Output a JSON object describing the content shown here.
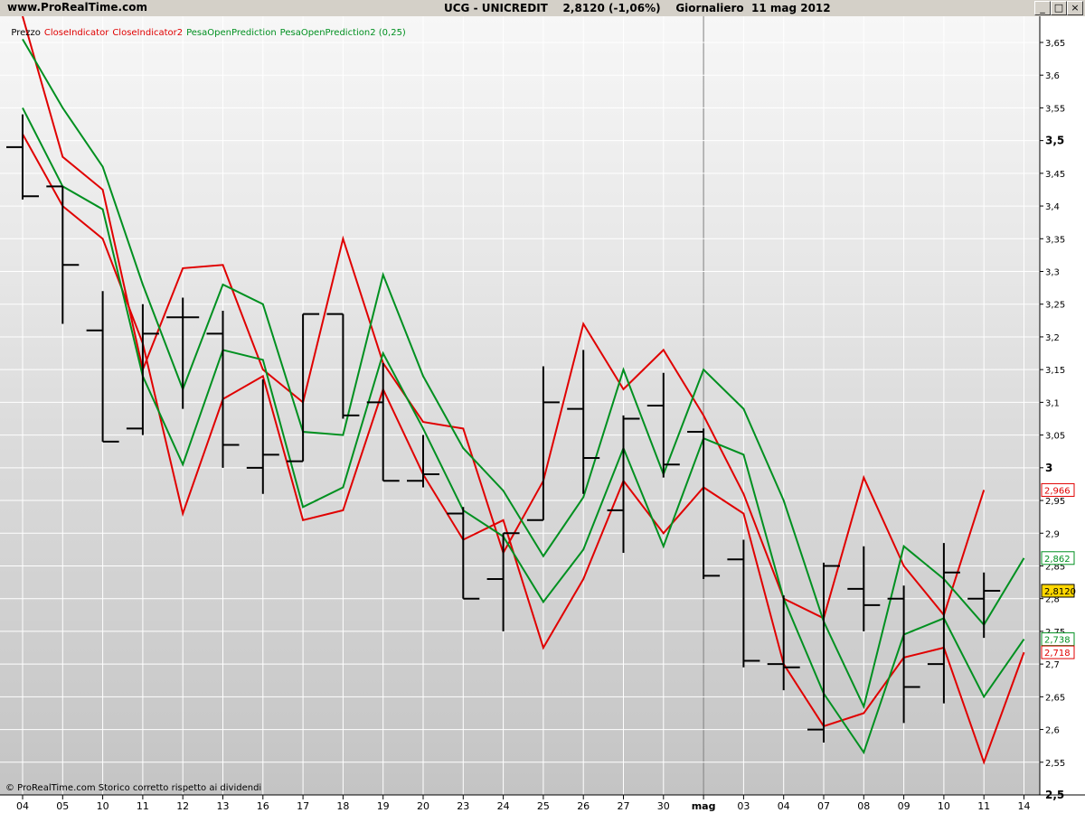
{
  "header": {
    "site": "www.ProRealTime.com",
    "title": "UCG - UNICREDIT    2,8120 (-1,06%)    Giornaliero  11 mag 2012"
  },
  "legend": {
    "price": "Prezzo",
    "ind1": "CloseIndicator",
    "ind2": "CloseIndicator2",
    "ind3": "PesaOpenPrediction",
    "ind4": "PesaOpenPrediction2 (0,25)"
  },
  "footer": "© ProRealTime.com  Storico corretto rispetto ai dividendi",
  "window_controls": [
    "_",
    "□",
    "×"
  ],
  "colors": {
    "price": "#000000",
    "close_indicator": "#e00000",
    "pesa_prediction": "#009020",
    "last_price_badge": "#ffd700"
  },
  "chart_data": {
    "type": "line",
    "title": "UCG - UNICREDIT",
    "x_labels": [
      "04",
      "05",
      "10",
      "11",
      "12",
      "13",
      "16",
      "17",
      "18",
      "19",
      "20",
      "23",
      "24",
      "25",
      "26",
      "27",
      "30",
      "mag",
      "03",
      "04",
      "07",
      "08",
      "09",
      "10",
      "11",
      "14"
    ],
    "ylim": [
      2.5,
      3.69
    ],
    "y_ticks": [
      "3,65",
      "3,6",
      "3,55",
      "3,5",
      "3,45",
      "3,4",
      "3,35",
      "3,3",
      "3,25",
      "3,2",
      "3,15",
      "3,1",
      "3,05",
      "3",
      "2,95",
      "2,9",
      "2,85",
      "2,8",
      "2,75",
      "2,7",
      "2,65",
      "2,6",
      "2,55",
      "2,5"
    ],
    "y_ticks_bold": [
      "3,5",
      "3",
      "2,5"
    ],
    "month_divider_index": 17,
    "ohlc": [
      {
        "o": 3.49,
        "h": 3.54,
        "l": 3.41,
        "c": 3.415
      },
      {
        "o": 3.43,
        "h": 3.43,
        "l": 3.22,
        "c": 3.31
      },
      {
        "o": 3.21,
        "h": 3.27,
        "l": 3.04,
        "c": 3.04
      },
      {
        "o": 3.06,
        "h": 3.25,
        "l": 3.05,
        "c": 3.205
      },
      {
        "o": 3.23,
        "h": 3.26,
        "l": 3.09,
        "c": 3.23
      },
      {
        "o": 3.205,
        "h": 3.24,
        "l": 3.0,
        "c": 3.035
      },
      {
        "o": 3.0,
        "h": 3.135,
        "l": 2.96,
        "c": 3.02
      },
      {
        "o": 3.01,
        "h": 3.235,
        "l": 3.01,
        "c": 3.235
      },
      {
        "o": 3.235,
        "h": 3.235,
        "l": 3.075,
        "c": 3.08
      },
      {
        "o": 3.1,
        "h": 3.16,
        "l": 2.98,
        "c": 2.98
      },
      {
        "o": 2.98,
        "h": 3.05,
        "l": 2.97,
        "c": 2.99
      },
      {
        "o": 2.93,
        "h": 2.94,
        "l": 2.8,
        "c": 2.8
      },
      {
        "o": 2.83,
        "h": 2.9,
        "l": 2.75,
        "c": 2.9
      },
      {
        "o": 2.92,
        "h": 3.155,
        "l": 2.92,
        "c": 3.1
      },
      {
        "o": 3.09,
        "h": 3.18,
        "l": 2.96,
        "c": 3.015
      },
      {
        "o": 2.935,
        "h": 3.08,
        "l": 2.87,
        "c": 3.075
      },
      {
        "o": 3.095,
        "h": 3.145,
        "l": 2.985,
        "c": 3.005
      },
      {
        "o": 3.055,
        "h": 3.06,
        "l": 2.83,
        "c": 2.835
      },
      {
        "o": 2.86,
        "h": 2.89,
        "l": 2.695,
        "c": 2.705
      },
      {
        "o": 2.7,
        "h": 2.805,
        "l": 2.66,
        "c": 2.695
      },
      {
        "o": 2.6,
        "h": 2.855,
        "l": 2.58,
        "c": 2.85
      },
      {
        "o": 2.815,
        "h": 2.88,
        "l": 2.75,
        "c": 2.79
      },
      {
        "o": 2.8,
        "h": 2.82,
        "l": 2.61,
        "c": 2.665
      },
      {
        "o": 2.7,
        "h": 2.885,
        "l": 2.64,
        "c": 2.84
      },
      {
        "o": 2.8,
        "h": 2.84,
        "l": 2.74,
        "c": 2.812
      }
    ],
    "series": [
      {
        "name": "CloseIndicator",
        "color": "#e00000",
        "values": [
          3.69,
          3.475,
          3.425,
          3.15,
          3.305,
          3.31,
          3.15,
          3.1,
          3.35,
          3.16,
          3.07,
          3.06,
          2.87,
          2.98,
          3.22,
          3.12,
          3.18,
          3.08,
          2.96,
          2.8,
          2.77,
          2.985,
          2.85,
          2.775,
          2.966
        ]
      },
      {
        "name": "CloseIndicator2",
        "color": "#e00000",
        "values": [
          3.51,
          3.4,
          3.35,
          3.19,
          2.93,
          3.105,
          3.14,
          2.92,
          2.935,
          3.12,
          2.99,
          2.89,
          2.92,
          2.725,
          2.83,
          2.98,
          2.9,
          2.97,
          2.93,
          2.7,
          2.605,
          2.625,
          2.71,
          2.725,
          2.55,
          2.718
        ]
      },
      {
        "name": "PesaOpenPrediction",
        "color": "#009020",
        "values": [
          3.655,
          3.55,
          3.46,
          3.28,
          3.12,
          3.28,
          3.25,
          3.055,
          3.05,
          3.295,
          3.14,
          3.03,
          2.965,
          2.865,
          2.955,
          3.15,
          2.99,
          3.15,
          3.09,
          2.95,
          2.765,
          2.635,
          2.88,
          2.83,
          2.76,
          2.862
        ]
      },
      {
        "name": "PesaOpenPrediction2 (0,25)",
        "color": "#009020",
        "values": [
          3.55,
          3.43,
          3.395,
          3.14,
          3.005,
          3.18,
          3.165,
          2.94,
          2.97,
          3.175,
          3.06,
          2.935,
          2.895,
          2.795,
          2.875,
          3.03,
          2.88,
          3.045,
          3.02,
          2.8,
          2.655,
          2.565,
          2.745,
          2.77,
          2.65,
          2.738
        ]
      }
    ],
    "axis_badges": [
      {
        "label": "2,966",
        "value": 2.966,
        "color": "#e00000",
        "fill": "#ffffff"
      },
      {
        "label": "2,862",
        "value": 2.862,
        "color": "#009020",
        "fill": "#ffffff"
      },
      {
        "label": "2,8120",
        "value": 2.812,
        "color": "#000000",
        "fill": "#ffd700"
      },
      {
        "label": "2,738",
        "value": 2.738,
        "color": "#009020",
        "fill": "#ffffff"
      },
      {
        "label": "2,718",
        "value": 2.718,
        "color": "#e00000",
        "fill": "#ffffff"
      }
    ]
  }
}
